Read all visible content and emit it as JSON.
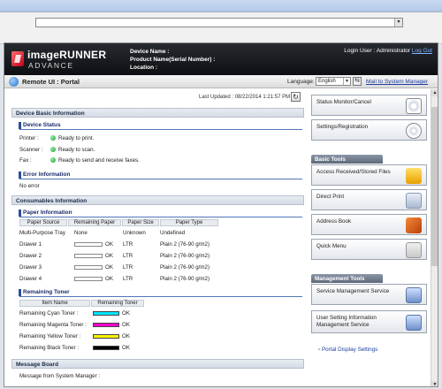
{
  "header": {
    "brand_line1": "imageRUNNER",
    "brand_line2": "ADVANCE",
    "device_name_label": "Device Name :",
    "product_name_label": "Product Name(Serial Number) :",
    "location_label": "Location :",
    "login_user": "Login User : Administrator",
    "logout": "Log Out"
  },
  "portal": {
    "title": "Remote UI : Portal",
    "language_label": "Language:",
    "language_value": "English",
    "mail_link": "Mail to System Manager"
  },
  "main": {
    "last_updated": "Last Updated : 08/22/2014 1:21:57 PM",
    "device_basic_info": "Device Basic Information",
    "device_status": "Device Status",
    "status_rows": [
      {
        "label": "Printer :",
        "value": "Ready to print."
      },
      {
        "label": "Scanner :",
        "value": "Ready to scan."
      },
      {
        "label": "Fax :",
        "value": "Ready to send and receive faxes."
      }
    ],
    "error_info": "Error Information",
    "error_value": "No error",
    "consumables_info": "Consumables Information",
    "paper_info": "Paper Information",
    "paper_headers": [
      "Paper Source",
      "Remaining Paper",
      "Paper Size",
      "Paper Type"
    ],
    "paper_rows": [
      {
        "source": "Multi-Purpose Tray",
        "remaining": "None",
        "size": "Unknown",
        "type": "Undefined",
        "bar": false
      },
      {
        "source": "Drawer 1",
        "remaining": "OK",
        "size": "LTR",
        "type": "Plain 2 (76-90 g/m2)",
        "bar": true
      },
      {
        "source": "Drawer 2",
        "remaining": "OK",
        "size": "LTR",
        "type": "Plain 2 (76-90 g/m2)",
        "bar": true
      },
      {
        "source": "Drawer 3",
        "remaining": "OK",
        "size": "LTR",
        "type": "Plain 2 (76-90 g/m2)",
        "bar": true
      },
      {
        "source": "Drawer 4",
        "remaining": "OK",
        "size": "LTR",
        "type": "Plain 2 (76-90 g/m2)",
        "bar": true
      }
    ],
    "remaining_toner": "Remaining Toner",
    "toner_headers": [
      "Item Name",
      "Remaining Toner"
    ],
    "toner_rows": [
      {
        "name": "Remaining Cyan Toner :",
        "value": "OK",
        "color": "#00e5ff"
      },
      {
        "name": "Remaining Magenta Toner :",
        "value": "OK",
        "color": "#ff00d0"
      },
      {
        "name": "Remaining Yellow Toner :",
        "value": "OK",
        "color": "#fff200"
      },
      {
        "name": "Remaining Black Toner :",
        "value": "OK",
        "color": "#000000"
      }
    ],
    "message_board": "Message Board",
    "message_from": "Message from System Manager :"
  },
  "side": {
    "status_monitor": "Status Monitor/Cancel",
    "settings": "Settings/Registration",
    "basic_tools": "Basic Tools",
    "access_files": "Access Received/Stored Files",
    "direct_print": "Direct Print",
    "address_book": "Address Book",
    "quick_menu": "Quick Menu",
    "management_tools": "Management Tools",
    "service_mgmt": "Service Management Service",
    "user_setting_1": "User Setting Information",
    "user_setting_2": "Management Service",
    "portal_display": "Portal Display Settings"
  }
}
